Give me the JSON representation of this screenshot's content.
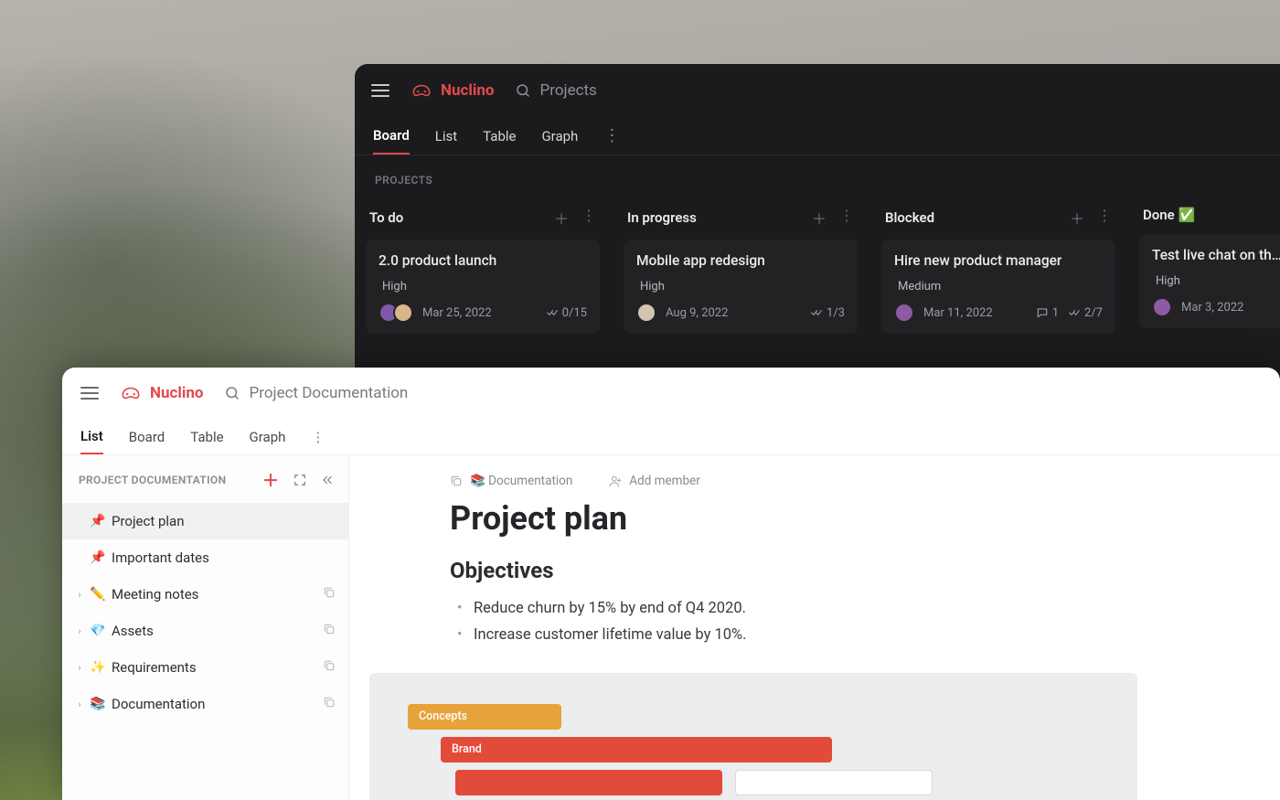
{
  "brand": "Nuclino",
  "dark": {
    "search_placeholder": "Projects",
    "tabs": [
      "Board",
      "List",
      "Table",
      "Graph"
    ],
    "active_tab": "Board",
    "section_label": "PROJECTS",
    "columns": [
      {
        "title": "To do"
      },
      {
        "title": "In progress"
      },
      {
        "title": "Blocked"
      },
      {
        "title": "Done ✅"
      }
    ],
    "cards": {
      "todo": {
        "title": "2.0 product launch",
        "priority": "High",
        "date": "Mar 25, 2022",
        "checks": "0/15"
      },
      "inprogress": {
        "title": "Mobile app redesign",
        "priority": "High",
        "date": "Aug 9, 2022",
        "checks": "1/3"
      },
      "blocked": {
        "title": "Hire new product manager",
        "priority": "Medium",
        "date": "Mar 11, 2022",
        "comments": "1",
        "checks": "2/7"
      },
      "done": {
        "title": "Test live chat on the w",
        "priority": "High",
        "date": "Mar 3, 2022"
      }
    }
  },
  "light": {
    "search_placeholder": "Project Documentation",
    "tabs": [
      "List",
      "Board",
      "Table",
      "Graph"
    ],
    "active_tab": "List",
    "sidebar_label": "PROJECT DOCUMENTATION",
    "tree": [
      {
        "icon": "📌",
        "label": "Project plan",
        "pinned": true,
        "active": true
      },
      {
        "icon": "📌",
        "label": "Important dates",
        "pinned": true
      },
      {
        "icon": "✏️",
        "label": "Meeting notes",
        "expandable": true,
        "copy": true
      },
      {
        "icon": "💎",
        "label": "Assets",
        "expandable": true,
        "copy": true
      },
      {
        "icon": "✨",
        "label": "Requirements",
        "expandable": true,
        "copy": true
      },
      {
        "icon": "📚",
        "label": "Documentation",
        "expandable": true,
        "copy": true
      }
    ],
    "breadcrumb": "📚 Documentation",
    "add_member": "Add member",
    "doc_title": "Project plan",
    "h2": "Objectives",
    "bullets": [
      "Reduce churn by 15% by end of Q4 2020.",
      "Increase customer lifetime value by 10%."
    ],
    "gantt": {
      "b1": "Concepts",
      "b2": "Brand"
    }
  }
}
